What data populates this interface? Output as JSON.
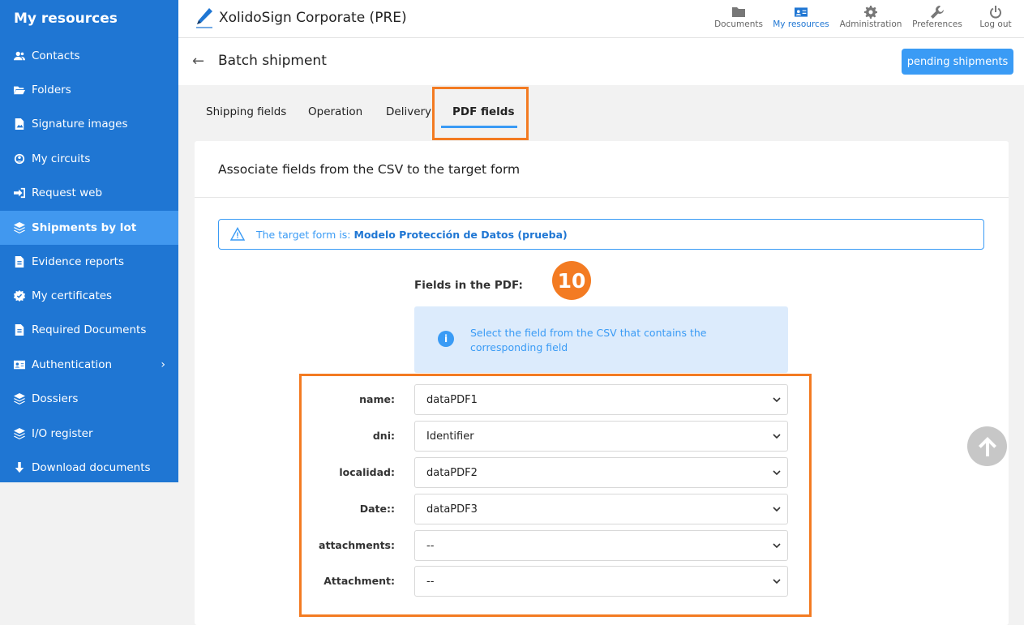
{
  "sidebar": {
    "title": "My resources",
    "items": [
      {
        "label": "Contacts",
        "icon": "contacts-icon"
      },
      {
        "label": "Folders",
        "icon": "folder-open-icon"
      },
      {
        "label": "Signature images",
        "icon": "image-file-icon"
      },
      {
        "label": "My circuits",
        "icon": "circuit-icon"
      },
      {
        "label": "Request web",
        "icon": "sign-in-icon"
      },
      {
        "label": "Shipments by lot",
        "icon": "layers-icon",
        "active": true
      },
      {
        "label": "Evidence reports",
        "icon": "file-text-icon"
      },
      {
        "label": "My certificates",
        "icon": "certificate-icon"
      },
      {
        "label": "Required Documents",
        "icon": "file-text-icon"
      },
      {
        "label": "Authentication",
        "icon": "id-card-icon",
        "has_submenu": true,
        "chevron": "›"
      },
      {
        "label": "Dossiers",
        "icon": "layers-icon"
      },
      {
        "label": "I/O register",
        "icon": "layers-icon"
      },
      {
        "label": "Download documents",
        "icon": "download-icon"
      }
    ]
  },
  "topbar": {
    "brand": "XolidoSign Corporate (PRE)",
    "nav": [
      {
        "label": "Documents",
        "icon": "folder-icon"
      },
      {
        "label": "My resources",
        "icon": "id-card-icon",
        "active": true
      },
      {
        "label": "Administration",
        "icon": "gear-icon"
      },
      {
        "label": "Preferences",
        "icon": "wrench-icon"
      },
      {
        "label": "Log out",
        "icon": "power-icon"
      }
    ]
  },
  "page": {
    "back": "←",
    "title": "Batch shipment",
    "pending_button": "pending shipments"
  },
  "tabs": [
    {
      "label": "Shipping fields"
    },
    {
      "label": "Operation"
    },
    {
      "label": "Delivery"
    },
    {
      "label": "PDF fields",
      "active": true
    }
  ],
  "card": {
    "title": "Associate fields from the CSV to the target form",
    "alert_prefix": "The target form is: ",
    "alert_form": "Modelo Protección de Datos (prueba)",
    "fields_title": "Fields in the PDF:",
    "step_number": "10",
    "info_icon": "i",
    "info_text": "Select the field from the CSV that contains the corresponding field",
    "rows": [
      {
        "label": "name:",
        "value": "dataPDF1"
      },
      {
        "label": "dni:",
        "value": "Identifier"
      },
      {
        "label": "localidad:",
        "value": "dataPDF2"
      },
      {
        "label": "Date::",
        "value": "dataPDF3"
      },
      {
        "label": "attachments:",
        "value": "--"
      },
      {
        "label": "Attachment:",
        "value": "--"
      }
    ]
  },
  "colors": {
    "sidebar_bg": "#1f76d3",
    "accent": "#3a9bf5",
    "highlight": "#f37b22"
  }
}
